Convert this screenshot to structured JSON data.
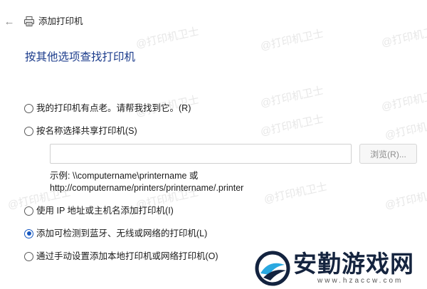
{
  "window": {
    "title": "添加打印机"
  },
  "heading": "按其他选项查找打印机",
  "options": [
    {
      "label": "我的打印机有点老。请帮我找到它。(R)",
      "selected": false
    },
    {
      "label": "按名称选择共享打印机(S)",
      "selected": false
    },
    {
      "label": "使用 IP 地址或主机名添加打印机(I)",
      "selected": false
    },
    {
      "label": "添加可检测到蓝牙、无线或网络的打印机(L)",
      "selected": true
    },
    {
      "label": "通过手动设置添加本地打印机或网络打印机(O)",
      "selected": false
    }
  ],
  "share": {
    "value": "",
    "browse_label": "浏览(R)...",
    "example_line1": "示例: \\\\computername\\printername 或",
    "example_line2": "http://computername/printers/printername/.printer"
  },
  "watermark": {
    "text": "@打印机卫士"
  },
  "site_logo": {
    "name": "安勤游戏网",
    "url": "www.hzaccw.com"
  },
  "colors": {
    "heading": "#1c3c8c",
    "radio_selected": "#1557c0"
  },
  "icons": {
    "back": "arrow-left",
    "printer": "printer"
  }
}
